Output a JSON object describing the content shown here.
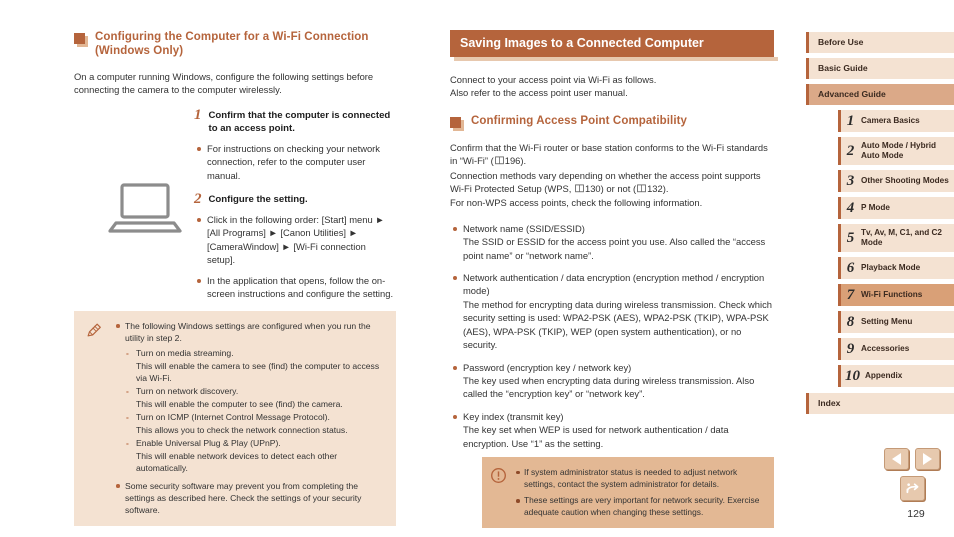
{
  "colors": {
    "accent": "#b5643c",
    "callout_bg": "#f4e2d2",
    "callout_inset_bg": "#e3b894",
    "nav_active_bg": "#d9a077",
    "nav_group_bg": "#dba988"
  },
  "left_column": {
    "heading": "Configuring the Computer for a Wi-Fi Connection (Windows Only)",
    "intro": "On a computer running Windows, configure the following settings before connecting the camera to the computer wirelessly.",
    "illustration": "laptop-illustration",
    "steps": [
      {
        "number": "1",
        "title": "Confirm that the computer is connected to an access point.",
        "bullets": [
          "For instructions on checking your network connection, refer to the computer user manual."
        ]
      },
      {
        "number": "2",
        "title": "Configure the setting.",
        "bullets": [
          "Click in the following order: [Start] menu ► [All Programs] ► [Canon Utilities] ► [CameraWindow] ► [Wi-Fi connection setup].",
          "In the application that opens, follow the on-screen instructions and configure the setting."
        ]
      }
    ],
    "note_box": {
      "icon": "pencil-icon",
      "bullets": [
        "The following Windows settings are configured when you run the utility in step 2.",
        "Some security software may prevent you from completing the settings as described here. Check the settings of your security software."
      ],
      "sub_items": [
        {
          "dash": "Turn on media streaming.",
          "cont": "This will enable the camera to see (find) the computer to access via Wi-Fi."
        },
        {
          "dash": "Turn on network discovery.",
          "cont": "This will enable the computer to see (find) the camera."
        },
        {
          "dash": "Turn on ICMP (Internet Control Message Protocol).",
          "cont": "This allows you to check the network connection status."
        },
        {
          "dash": "Enable Universal Plug & Play (UPnP).",
          "cont": "This will enable network devices to detect each other automatically."
        }
      ]
    }
  },
  "middle_column": {
    "title": "Saving Images to a Connected Computer",
    "intro_line1": "Connect to your access point via Wi-Fi as follows.",
    "intro_line2": "Also refer to the access point user manual.",
    "subheading": "Confirming Access Point Compatibility",
    "para1_a": "Confirm that the Wi-Fi router or base station conforms to the Wi-Fi standards in “Wi-Fi” (",
    "para1_ref": "196",
    "para1_b": ").",
    "para2_a": "Connection methods vary depending on whether the access point supports Wi-Fi Protected Setup (WPS, ",
    "para2_ref1": "130",
    "para2_b": ") or not (",
    "para2_ref2": "132",
    "para2_c": ").",
    "para3": "For non-WPS access points, check the following information.",
    "info_bullets": [
      {
        "term": "Network name (SSID/ESSID)",
        "desc": "The SSID or ESSID for the access point you use. Also called the “access point name” or “network name”."
      },
      {
        "term": "Network authentication / data encryption (encryption method / encryption mode)",
        "desc": "The method for encrypting data during wireless transmission. Check which security setting is used: WPA2-PSK (AES), WPA2-PSK (TKIP), WPA-PSK (AES), WPA-PSK (TKIP), WEP (open system authentication), or no security."
      },
      {
        "term": "Password (encryption key / network key)",
        "desc": "The key used when encrypting data during wireless transmission. Also called the “encryption key” or “network key”."
      },
      {
        "term": "Key index (transmit key)",
        "desc": "The key set when WEP is used for network authentication / data encryption. Use “1” as the setting."
      }
    ],
    "caution_box": {
      "icon": "caution-icon",
      "bullets": [
        "If system administrator status is needed to adjust network settings, contact the system administrator for details.",
        "These settings are very important for network security. Exercise adequate caution when changing these settings."
      ]
    }
  },
  "sidebar": {
    "top_items": [
      {
        "label": "Before Use",
        "active": false,
        "group": false
      },
      {
        "label": "Basic Guide",
        "active": false,
        "group": false
      },
      {
        "label": "Advanced Guide",
        "active": false,
        "group": true
      }
    ],
    "chapters": [
      {
        "number": "1",
        "label": "Camera Basics",
        "active": false
      },
      {
        "number": "2",
        "label": "Auto Mode / Hybrid Auto Mode",
        "active": false
      },
      {
        "number": "3",
        "label": "Other Shooting Modes",
        "active": false
      },
      {
        "number": "4",
        "label": "P Mode",
        "active": false
      },
      {
        "number": "5",
        "label": "Tv, Av, M, C1, and C2 Mode",
        "active": false
      },
      {
        "number": "6",
        "label": "Playback Mode",
        "active": false
      },
      {
        "number": "7",
        "label": "Wi-Fi Functions",
        "active": true
      },
      {
        "number": "8",
        "label": "Setting Menu",
        "active": false
      },
      {
        "number": "9",
        "label": "Accessories",
        "active": false
      },
      {
        "number": "10",
        "label": "Appendix",
        "active": false
      }
    ],
    "bottom_items": [
      {
        "label": "Index",
        "active": false,
        "group": false
      }
    ]
  },
  "footer": {
    "page_number": "129",
    "prev_button": "previous-page-button",
    "next_button": "next-page-button",
    "return_button": "return-button"
  }
}
